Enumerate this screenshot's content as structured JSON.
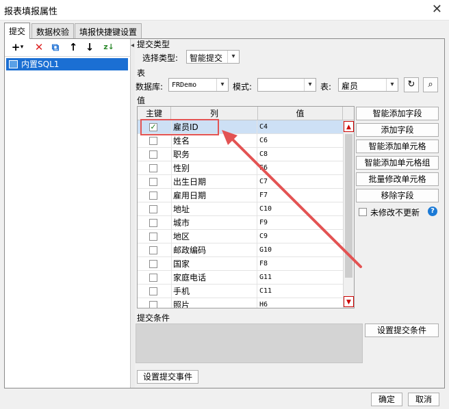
{
  "window": {
    "title": "报表填报属性",
    "close": "✕"
  },
  "tabs": [
    {
      "label": "提交"
    },
    {
      "label": "数据校验"
    },
    {
      "label": "填报快捷键设置"
    }
  ],
  "tree": {
    "items": [
      {
        "label": "内置SQL1"
      }
    ]
  },
  "toolbar": {
    "add": "+",
    "add_dd": "▾",
    "delete": "✕",
    "copy": "⧉",
    "up": "↑",
    "down": "↓",
    "sort": "z↓"
  },
  "submit_type": {
    "section": "提交类型",
    "label": "选择类型:",
    "value": "智能提交"
  },
  "table_section": {
    "section": "表",
    "db_label": "数据库:",
    "db_value": "FRDemo",
    "mode_label": "模式:",
    "mode_value": "",
    "table_label": "表:",
    "table_value": "雇员"
  },
  "values_section": {
    "section": "值",
    "headers": {
      "key": "主键",
      "col": "列",
      "val": "值"
    },
    "rows": [
      {
        "col": "雇员ID",
        "val": "C4",
        "key": "✓"
      },
      {
        "col": "姓名",
        "val": "C6",
        "key": ""
      },
      {
        "col": "职务",
        "val": "C8",
        "key": ""
      },
      {
        "col": "性别",
        "val": "E6",
        "key": ""
      },
      {
        "col": "出生日期",
        "val": "C7",
        "key": ""
      },
      {
        "col": "雇用日期",
        "val": "F7",
        "key": ""
      },
      {
        "col": "地址",
        "val": "C10",
        "key": ""
      },
      {
        "col": "城市",
        "val": "F9",
        "key": ""
      },
      {
        "col": "地区",
        "val": "C9",
        "key": ""
      },
      {
        "col": "邮政编码",
        "val": "G10",
        "key": ""
      },
      {
        "col": "国家",
        "val": "F8",
        "key": ""
      },
      {
        "col": "家庭电话",
        "val": "G11",
        "key": ""
      },
      {
        "col": "手机",
        "val": "C11",
        "key": ""
      },
      {
        "col": "照片",
        "val": "H6",
        "key": ""
      }
    ]
  },
  "side_buttons": {
    "smart_add_field": "智能添加字段",
    "add_field": "添加字段",
    "smart_add_cell": "智能添加单元格",
    "smart_add_cell_group": "智能添加单元格组",
    "batch_modify_cell": "批量修改单元格",
    "remove_field": "移除字段",
    "no_update_unmodified": "未修改不更新",
    "help": "?"
  },
  "condition": {
    "section": "提交条件",
    "set_button": "设置提交条件"
  },
  "event_button": "设置提交事件",
  "footer": {
    "ok": "确定",
    "cancel": "取消"
  },
  "colors": {
    "selection": "#1b6fd3",
    "highlight": "#e35353",
    "help": "#1b7ad6"
  }
}
